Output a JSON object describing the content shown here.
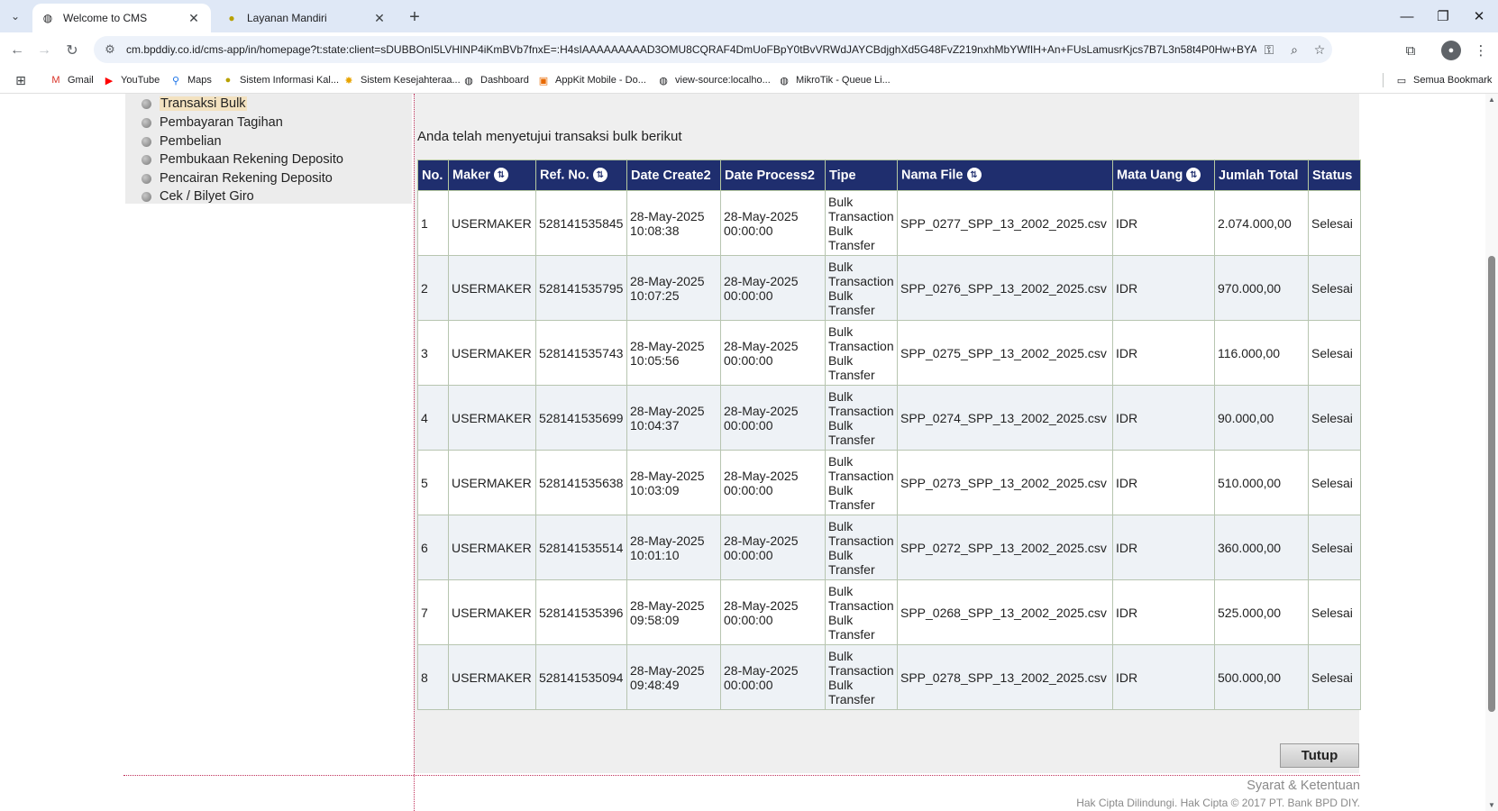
{
  "browser": {
    "tabs": [
      {
        "title": "Welcome to CMS",
        "active": true,
        "favicon": "globe-icon"
      },
      {
        "title": "Layanan Mandiri",
        "active": false,
        "favicon": "site-logo-icon"
      }
    ],
    "url": "cm.bpddiy.co.id/cms-app/in/homepage?t:state:client=sDUBBOnI5LVHINP4iKmBVb7fnxE=:H4sIAAAAAAAAAD3OMU8CQRAF4DmUoFBpY0tBvVRWdJAYCBdjghXd5G48FvZ219nxhMbYWfIH+An+FUsLamusrKjcs7B7L3n58t4P0Hw+BYAkMEwdFwo9Z...",
    "bookmarks": [
      {
        "label": "Gmail",
        "icon": "gmail-icon"
      },
      {
        "label": "YouTube",
        "icon": "youtube-icon"
      },
      {
        "label": "Maps",
        "icon": "maps-icon"
      },
      {
        "label": "Sistem Informasi Kal...",
        "icon": "site-logo-icon"
      },
      {
        "label": "Sistem Kesejahteraa...",
        "icon": "site-logo-icon"
      },
      {
        "label": "Dashboard",
        "icon": "globe-icon"
      },
      {
        "label": "AppKit Mobile - Do...",
        "icon": "appkit-icon"
      },
      {
        "label": "view-source:localho...",
        "icon": "globe-icon"
      },
      {
        "label": "MikroTik - Queue Li...",
        "icon": "globe-icon"
      }
    ],
    "all_bookmarks_label": "Semua Bookmark"
  },
  "sidebar": {
    "items": [
      {
        "label": "Transaksi Bulk",
        "selected": true
      },
      {
        "label": "Pembayaran Tagihan"
      },
      {
        "label": "Pembelian"
      },
      {
        "label": "Pembukaan Rekening Deposito"
      },
      {
        "label": "Pencairan Rekening Deposito"
      },
      {
        "label": "Cek / Bilyet Giro"
      }
    ]
  },
  "main": {
    "message": "Anda telah menyetujui transaksi bulk berikut",
    "columns": [
      "No.",
      "Maker",
      "Ref. No.",
      "Date Create2",
      "Date Process2",
      "Tipe",
      "Nama File",
      "Mata Uang",
      "Jumlah Total",
      "Status"
    ],
    "rows": [
      {
        "no": "1",
        "maker": "USERMAKER",
        "ref": "528141535845",
        "create_date": "28-May-2025",
        "create_time": "10:08:38",
        "process_date": "28-May-2025",
        "process_time": "00:00:00",
        "tipe": [
          "Bulk",
          "Transaction",
          "Bulk",
          "Transfer"
        ],
        "file": "SPP_0277_SPP_13_2002_2025.csv",
        "currency": "IDR",
        "total": "2.074.000,00",
        "status": "Selesai"
      },
      {
        "no": "2",
        "maker": "USERMAKER",
        "ref": "528141535795",
        "create_date": "28-May-2025",
        "create_time": "10:07:25",
        "process_date": "28-May-2025",
        "process_time": "00:00:00",
        "tipe": [
          "Bulk",
          "Transaction",
          "Bulk",
          "Transfer"
        ],
        "file": "SPP_0276_SPP_13_2002_2025.csv",
        "currency": "IDR",
        "total": "970.000,00",
        "status": "Selesai"
      },
      {
        "no": "3",
        "maker": "USERMAKER",
        "ref": "528141535743",
        "create_date": "28-May-2025",
        "create_time": "10:05:56",
        "process_date": "28-May-2025",
        "process_time": "00:00:00",
        "tipe": [
          "Bulk",
          "Transaction",
          "Bulk",
          "Transfer"
        ],
        "file": "SPP_0275_SPP_13_2002_2025.csv",
        "currency": "IDR",
        "total": "116.000,00",
        "status": "Selesai"
      },
      {
        "no": "4",
        "maker": "USERMAKER",
        "ref": "528141535699",
        "create_date": "28-May-2025",
        "create_time": "10:04:37",
        "process_date": "28-May-2025",
        "process_time": "00:00:00",
        "tipe": [
          "Bulk",
          "Transaction",
          "Bulk",
          "Transfer"
        ],
        "file": "SPP_0274_SPP_13_2002_2025.csv",
        "currency": "IDR",
        "total": "90.000,00",
        "status": "Selesai"
      },
      {
        "no": "5",
        "maker": "USERMAKER",
        "ref": "528141535638",
        "create_date": "28-May-2025",
        "create_time": "10:03:09",
        "process_date": "28-May-2025",
        "process_time": "00:00:00",
        "tipe": [
          "Bulk",
          "Transaction",
          "Bulk",
          "Transfer"
        ],
        "file": "SPP_0273_SPP_13_2002_2025.csv",
        "currency": "IDR",
        "total": "510.000,00",
        "status": "Selesai"
      },
      {
        "no": "6",
        "maker": "USERMAKER",
        "ref": "528141535514",
        "create_date": "28-May-2025",
        "create_time": "10:01:10",
        "process_date": "28-May-2025",
        "process_time": "00:00:00",
        "tipe": [
          "Bulk",
          "Transaction",
          "Bulk",
          "Transfer"
        ],
        "file": "SPP_0272_SPP_13_2002_2025.csv",
        "currency": "IDR",
        "total": "360.000,00",
        "status": "Selesai"
      },
      {
        "no": "7",
        "maker": "USERMAKER",
        "ref": "528141535396",
        "create_date": "28-May-2025",
        "create_time": "09:58:09",
        "process_date": "28-May-2025",
        "process_time": "00:00:00",
        "tipe": [
          "Bulk",
          "Transaction",
          "Bulk",
          "Transfer"
        ],
        "file": "SPP_0268_SPP_13_2002_2025.csv",
        "currency": "IDR",
        "total": "525.000,00",
        "status": "Selesai"
      },
      {
        "no": "8",
        "maker": "USERMAKER",
        "ref": "528141535094",
        "create_date": "28-May-2025",
        "create_time": "09:48:49",
        "process_date": "28-May-2025",
        "process_time": "00:00:00",
        "tipe": [
          "Bulk",
          "Transaction",
          "Bulk",
          "Transfer"
        ],
        "file": "SPP_0278_SPP_13_2002_2025.csv",
        "currency": "IDR",
        "total": "500.000,00",
        "status": "Selesai"
      }
    ],
    "close_button": "Tutup"
  },
  "footer": {
    "terms": "Syarat & Ketentuan",
    "copyright": "Hak Cipta Dilindungi. Hak Cipta © 2017 PT. Bank BPD DIY."
  },
  "colors": {
    "header_bg": "#1f2e6e",
    "highlight": "#f3e2c0",
    "panel_bg": "#efefef"
  }
}
